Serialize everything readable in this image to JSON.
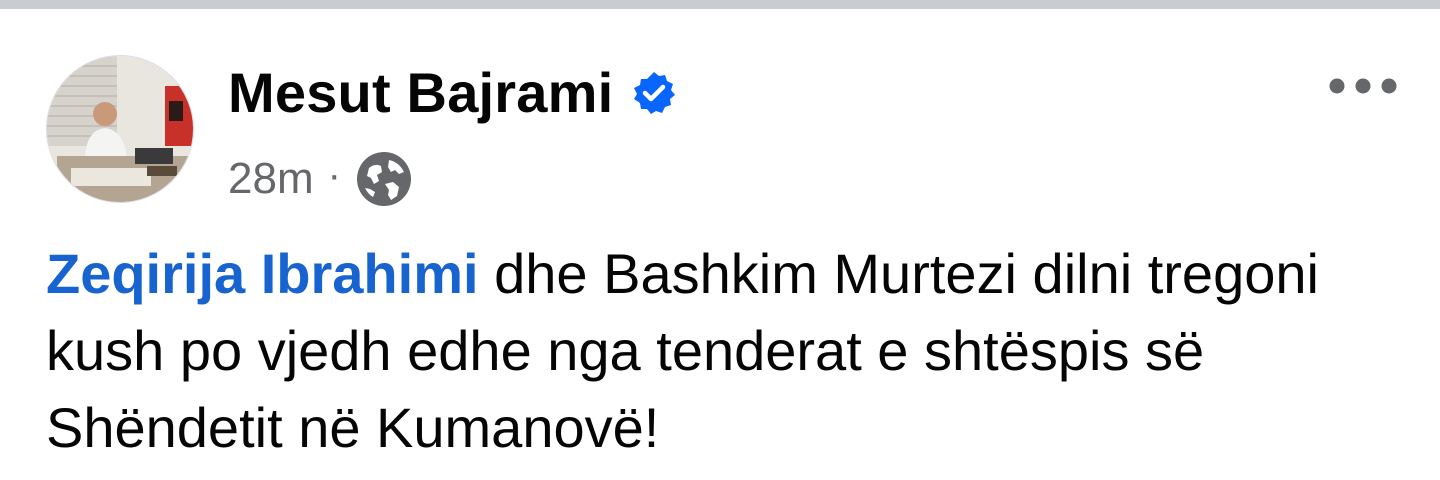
{
  "post": {
    "author": {
      "name": "Mesut Bajrami",
      "verified_icon": "verified-badge-icon",
      "avatar_icon": "profile-photo"
    },
    "meta": {
      "time": "28m",
      "separator": "·",
      "audience_icon": "globe-icon"
    },
    "menu_icon": "more-horizontal-icon",
    "body": {
      "mention": "Zeqirija Ibrahimi",
      "text": " dhe Bashkim Murtezi dilni tregoni kush po vjedh edhe nga tenderat e shtëspis së Shëndetit në Kumanovë!"
    }
  },
  "colors": {
    "mention": "#1763cf",
    "verified": "#0866ff",
    "secondary_text": "#65676b",
    "primary_text": "#050505"
  }
}
